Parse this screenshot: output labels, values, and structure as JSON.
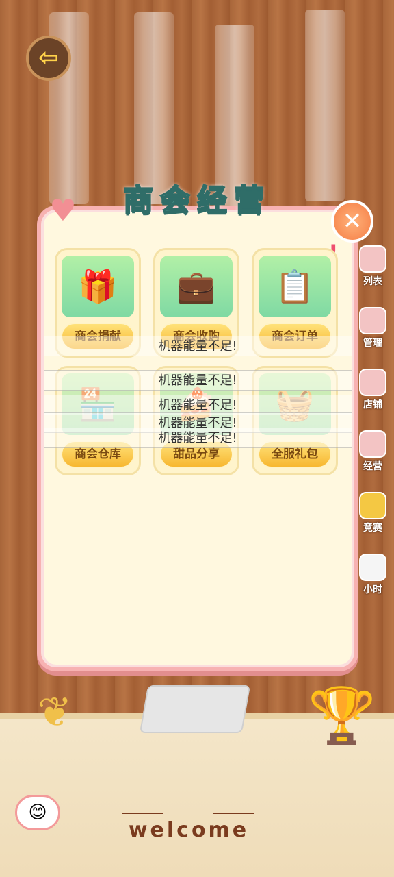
{
  "header": {
    "title": "商会经营"
  },
  "buttons": {
    "back_icon": "⇦",
    "close_icon": "✕",
    "alert": "!"
  },
  "cards": [
    {
      "label": "商会捐献",
      "icon": "🎁"
    },
    {
      "label": "商会收购",
      "icon": "💼"
    },
    {
      "label": "商会订单",
      "icon": "📋"
    },
    {
      "label": "商会仓库",
      "icon": "🏪"
    },
    {
      "label": "甜品分享",
      "icon": "🍰"
    },
    {
      "label": "全服礼包",
      "icon": "🧺"
    }
  ],
  "toasts": [
    "机器能量不足!",
    "机器能量不足!",
    "机器能量不足!",
    "机器能量不足!",
    "机器能量不足!"
  ],
  "side_menu": [
    {
      "label": "列表"
    },
    {
      "label": "管理"
    },
    {
      "label": "店铺"
    },
    {
      "label": "经营"
    },
    {
      "label": "竞赛"
    },
    {
      "label": "小时"
    }
  ],
  "footer": {
    "welcome": "welcome",
    "emoji": "😊"
  },
  "decor": {
    "trophy": "🏆",
    "stand": "❦",
    "heart": "♥"
  }
}
